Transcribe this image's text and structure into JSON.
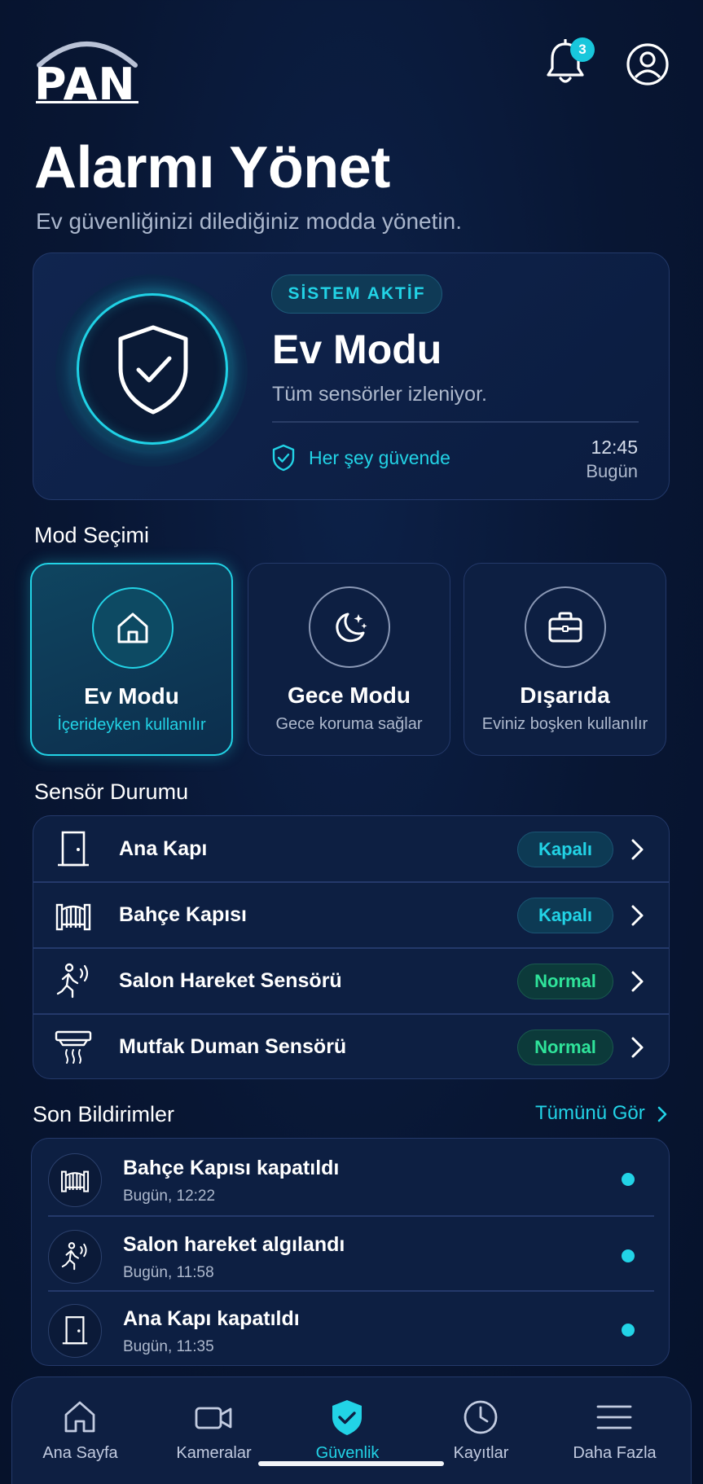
{
  "brand": {
    "logo_text": "PAN"
  },
  "header": {
    "notification_count": "3"
  },
  "page": {
    "title": "Alarmı Yönet",
    "subtitle": "Ev güvenliğinizi dilediğiniz modda yönetin."
  },
  "status": {
    "pill": "SİSTEM AKTİF",
    "mode": "Ev Modu",
    "description": "Tüm sensörler izleniyor.",
    "safe_text": "Her şey güvende",
    "time": "12:45",
    "day": "Bugün"
  },
  "mode_section": {
    "title": "Mod Seçimi",
    "modes": [
      {
        "name": "Ev Modu",
        "sub": "İçerideyken kullanılır",
        "icon": "home-icon",
        "active": true
      },
      {
        "name": "Gece Modu",
        "sub": "Gece koruma sağlar",
        "icon": "moon-icon",
        "active": false
      },
      {
        "name": "Dışarıda",
        "sub": "Eviniz boşken kullanılır",
        "icon": "briefcase-icon",
        "active": false
      }
    ]
  },
  "sensor_section": {
    "title": "Sensör Durumu",
    "sensors": [
      {
        "name": "Ana Kapı",
        "status": "Kapalı",
        "icon": "door-icon"
      },
      {
        "name": "Bahçe Kapısı",
        "status": "Kapalı",
        "icon": "gate-icon"
      },
      {
        "name": "Salon Hareket Sensörü",
        "status": "Normal",
        "icon": "motion-icon"
      },
      {
        "name": "Mutfak Duman Sensörü",
        "status": "Normal",
        "icon": "smoke-detector-icon"
      }
    ]
  },
  "notifications": {
    "title": "Son Bildirimler",
    "see_all": "Tümünü Gör",
    "items": [
      {
        "title": "Bahçe Kapısı kapatıldı",
        "time": "Bugün, 12:22",
        "icon": "gate-icon"
      },
      {
        "title": "Salon hareket algılandı",
        "time": "Bugün, 11:58",
        "icon": "motion-icon"
      },
      {
        "title": "Ana Kapı kapatıldı",
        "time": "Bugün, 11:35",
        "icon": "door-icon"
      }
    ]
  },
  "nav": {
    "items": [
      {
        "label": "Ana Sayfa",
        "icon": "home-icon"
      },
      {
        "label": "Kameralar",
        "icon": "camera-icon"
      },
      {
        "label": "Güvenlik",
        "icon": "shield-check-icon",
        "active": true
      },
      {
        "label": "Kayıtlar",
        "icon": "clock-icon"
      },
      {
        "label": "Daha Fazla",
        "icon": "menu-icon"
      }
    ]
  },
  "colors": {
    "accent": "#22d3e6",
    "background": "#081633",
    "card": "#0d1f42",
    "green_status": "#2fe39a"
  }
}
